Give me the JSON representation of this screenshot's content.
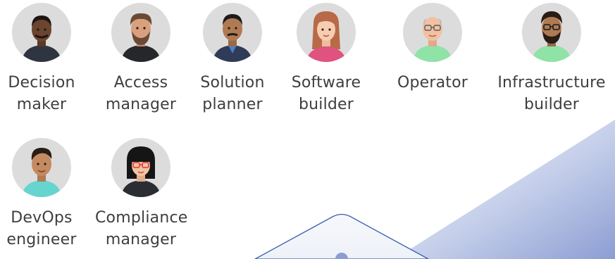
{
  "personas": [
    {
      "label_line1": "Decision",
      "label_line2": "maker",
      "avatar_icon": "decision-maker-avatar-icon"
    },
    {
      "label_line1": "Access",
      "label_line2": "manager",
      "avatar_icon": "access-manager-avatar-icon"
    },
    {
      "label_line1": "Solution",
      "label_line2": "planner",
      "avatar_icon": "solution-planner-avatar-icon"
    },
    {
      "label_line1": "Software",
      "label_line2": "builder",
      "avatar_icon": "software-builder-avatar-icon"
    },
    {
      "label_line1": "Operator",
      "label_line2": "",
      "avatar_icon": "operator-avatar-icon"
    },
    {
      "label_line1": "Infrastructure",
      "label_line2": "builder",
      "avatar_icon": "infrastructure-builder-avatar-icon"
    },
    {
      "label_line1": "DevOps",
      "label_line2": "engineer",
      "avatar_icon": "devops-engineer-avatar-icon"
    },
    {
      "label_line1": "Compliance",
      "label_line2": "manager",
      "avatar_icon": "compliance-manager-avatar-icon"
    }
  ],
  "colors": {
    "avatar_bg": "#dcdcdc",
    "label_text": "#3e3e3e",
    "decoration_gradient_start": "#e9edf6",
    "decoration_gradient_end": "#8c9dd3",
    "outline_accent": "#3a5fb0"
  }
}
